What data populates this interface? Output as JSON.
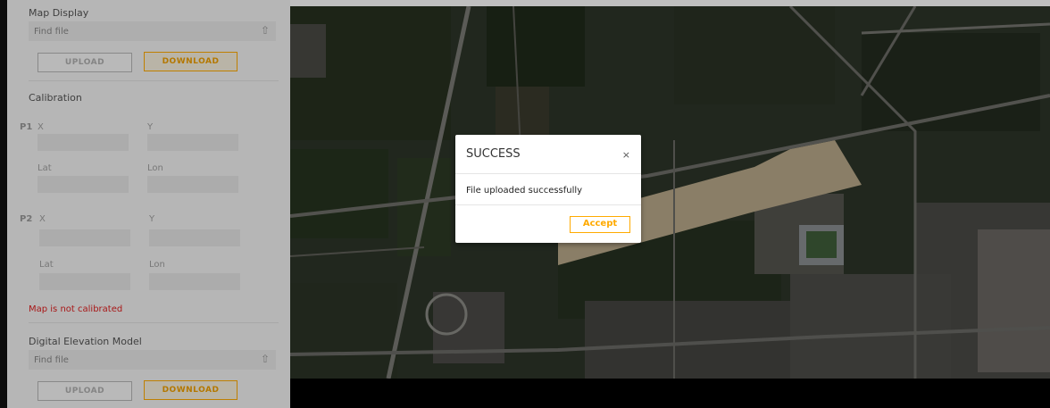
{
  "sidebar": {
    "map_display": {
      "title": "Map Display",
      "file_placeholder": "Find file",
      "upload_label": "UPLOAD",
      "download_label": "DOWNLOAD"
    },
    "calibration": {
      "title": "Calibration",
      "p1": {
        "label": "P1",
        "x": "X",
        "y": "Y",
        "lat": "Lat",
        "lon": "Lon"
      },
      "p2": {
        "label": "P2",
        "x": "X",
        "y": "Y",
        "lat": "Lat",
        "lon": "Lon"
      },
      "status": "Map is not calibrated"
    },
    "dem": {
      "title": "Digital Elevation Model",
      "file_placeholder": "Find file",
      "upload_label": "UPLOAD",
      "download_label": "DOWNLOAD"
    }
  },
  "dialog": {
    "title": "SUCCESS",
    "close": "×",
    "message": "File uploaded successfully",
    "accept": "Accept"
  },
  "icons": {
    "upload": "upload-icon",
    "close": "close-icon"
  },
  "colors": {
    "accent": "#ffaa00",
    "error": "#e02020"
  }
}
